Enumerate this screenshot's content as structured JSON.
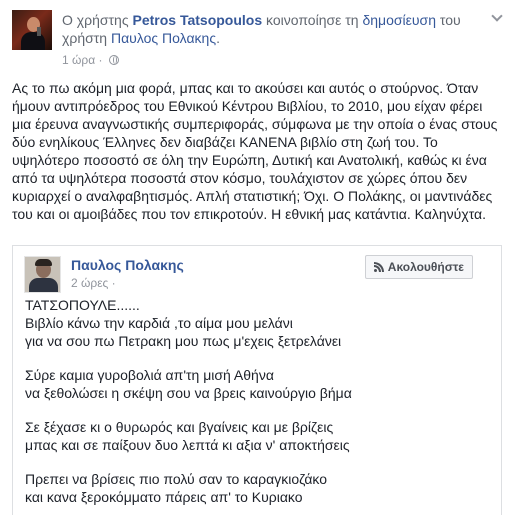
{
  "header": {
    "prefix": "Ο χρήστης ",
    "sharer_name": "Petros Tatsopoulos",
    "middle": " κοινοποίησε τη ",
    "post_link": "δημοσίευση",
    "after_link": " του χρήστη ",
    "author_name": "Παυλος Πολακης",
    "suffix": ".",
    "time": "1 ώρα ·",
    "privacy_icon": "globe-icon"
  },
  "post": {
    "text": "Ας το πω ακόμη μια φορά, μπας και το ακούσει και αυτός ο στούρνος. Όταν ήμουν αντιπρόεδρος του Εθνικού Κέντρου Βιβλίου, το 2010, μου είχαν φέρει μια έρευνα αναγνωστικής συμπεριφοράς, σύμφωνα με την οποία ο ένας στους δύο ενηλίκους Έλληνες δεν διαβάζει ΚΑΝΕΝΑ βιβλίο στη ζωή του. Το υψηλότερο ποσοστό σε όλη την Ευρώπη, Δυτική και Ανατολική, καθώς κι ένα από τα υψηλότερα ποσοστά στον κόσμο, τουλάχιστον σε χώρες όπου δεν κυριαρχεί ο αναλφαβητισμός. Απλή στατιστική; Όχι. Ο Πολάκης, οι μαντινάδες του και οι αμοιβάδες που τον επικροτούν. Η εθνική μας κατάντια. Καληνύχτα."
  },
  "shared": {
    "author_name": "Παυλος Πολακης",
    "time": "2 ώρες ·",
    "follow_label": "Ακολουθήστε",
    "stanzas": [
      [
        "ΤΑΤΣΟΠΟΥΛΕ......",
        "Βιβλίο κάνω την καρδιά ,το αίμα μου μελάνι",
        "για να σου πω Πετρακη μου πως μ'εχεις ξετρελάνει"
      ],
      [
        "Σύρε καμια γυροβολιά απ'τη μισή Αθήνα",
        "να ξεθολώσει η σκέψη σου να βρεις καινούργιο βήμα"
      ],
      [
        "Σε ξέχασε κι ο θυρωρός και βγαίνεις και με βρίζεις",
        "μπας και σε παίξουν δυο λεπτά κι αξια ν' αποκτήσεις"
      ],
      [
        "Πρεπει να βρίσεις πιο πολύ σαν το καραγκιοζάκο",
        "και κανα ξεροκόμματο πάρεις απ' το Κυριακο"
      ]
    ]
  }
}
